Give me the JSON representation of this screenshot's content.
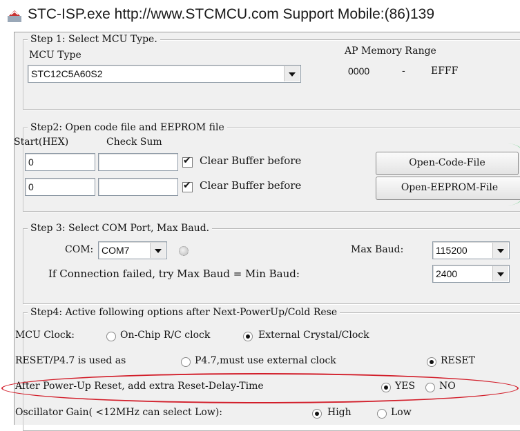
{
  "window": {
    "title": "STC-ISP.exe  http://www.STCMCU.com  Support Mobile:(86)139",
    "icon": "stc-app-icon"
  },
  "step1": {
    "legend": "Step 1: Select MCU Type.",
    "mcu_type_label": "MCU Type",
    "mcu_type_value": "STC12C5A60S2",
    "ap_memory_label": "AP Memory Range",
    "range_start": "0000",
    "range_dash": "-",
    "range_end": "EFFF"
  },
  "step2": {
    "legend": "Step2: Open code file and EEPROM file",
    "start_hex_label": "Start(HEX)",
    "check_sum_label": "Check Sum",
    "code_start": "0",
    "code_checksum": "",
    "code_clear_label": "Clear Buffer before",
    "open_code_button": "Open-Code-File",
    "eeprom_start": "0",
    "eeprom_checksum": "",
    "eeprom_clear_label": "Clear Buffer before",
    "open_eeprom_button": "Open-EEPROM-File"
  },
  "step3": {
    "legend": "Step 3: Select COM Port, Max Baud.",
    "com_label": "COM:",
    "com_value": "COM7",
    "max_baud_label": "Max Baud:",
    "max_baud_value": "115200",
    "fail_text": "If Connection failed, try Max Baud = Min Baud:",
    "min_baud_value": "2400"
  },
  "step4": {
    "legend": "Step4: Active following options after Next-PowerUp/Cold Rese",
    "clock_label": "MCU Clock:",
    "clock_opt1": "On-Chip R/C clock",
    "clock_opt2": "External Crystal/Clock",
    "reset_label": "RESET/P4.7 is used as",
    "reset_opt1": "P4.7,must use external clock",
    "reset_opt2": "RESET",
    "delay_label": "After Power-Up Reset, add extra Reset-Delay-Time",
    "delay_yes": "YES",
    "delay_no": "NO",
    "gain_label": "Oscillator Gain( <12MHz can select Low):",
    "gain_high": "High",
    "gain_low": "Low"
  },
  "colors": {
    "highlight_oval": "#d21e2a",
    "window_bg": "#f0f0f0"
  }
}
